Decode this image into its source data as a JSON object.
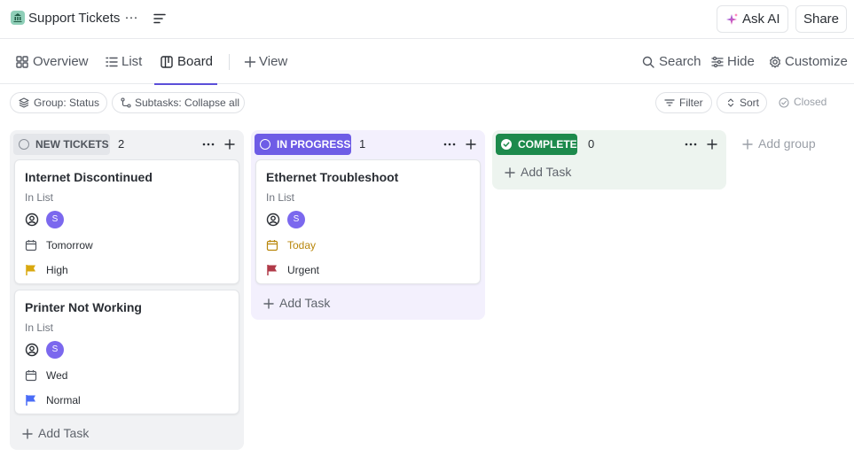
{
  "header": {
    "title": "Support Tickets",
    "ask_ai_label": "Ask AI",
    "share_label": "Share"
  },
  "tabs": {
    "overview": "Overview",
    "list": "List",
    "board": "Board",
    "add_view": "View",
    "search": "Search",
    "hide": "Hide",
    "customize": "Customize"
  },
  "filters": {
    "group": "Group: Status",
    "subtasks": "Subtasks: Collapse all",
    "filter": "Filter",
    "sort": "Sort",
    "closed": "Closed"
  },
  "columns": [
    {
      "status": "NEW TICKETS",
      "count": "2",
      "add_task": "Add Task",
      "cards": [
        {
          "title": "Internet Discontinued",
          "list": "In List",
          "assignee": "S",
          "date": "Tomorrow",
          "priority": "High",
          "priority_color": "#d9a80f"
        },
        {
          "title": "Printer Not Working",
          "list": "In List",
          "assignee": "S",
          "date": "Wed",
          "priority": "Normal",
          "priority_color": "#4a6cf7"
        }
      ]
    },
    {
      "status": "IN PROGRESS",
      "count": "1",
      "add_task": "Add Task",
      "cards": [
        {
          "title": "Ethernet Troubleshoot",
          "list": "In List",
          "assignee": "S",
          "date": "Today",
          "priority": "Urgent",
          "priority_color": "#b03a48"
        }
      ]
    },
    {
      "status": "COMPLETE",
      "count": "0",
      "add_task": "Add Task",
      "cards": []
    }
  ],
  "add_group": "Add group",
  "colors": {
    "accent": "#5b4fd9",
    "in_progress": "#6e5ce6",
    "complete": "#1d8a4c",
    "avatar": "#7b68ee"
  }
}
